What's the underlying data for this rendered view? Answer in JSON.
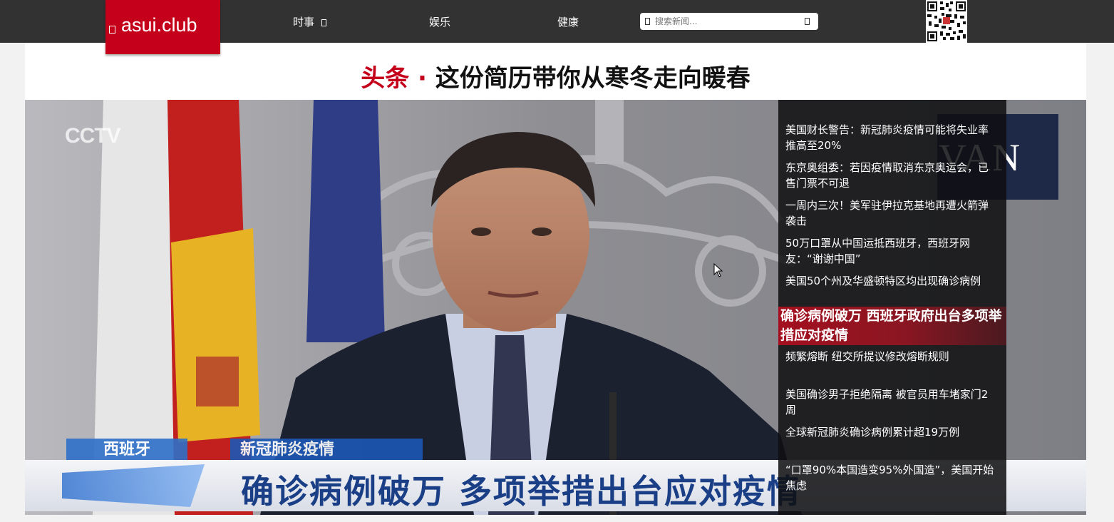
{
  "site": {
    "logo_text": "asui.club"
  },
  "nav": {
    "items": [
      {
        "label": "时事",
        "has_dropdown": true
      },
      {
        "label": "娱乐"
      },
      {
        "label": "健康"
      }
    ]
  },
  "search": {
    "placeholder": "搜索新闻..."
  },
  "headline": {
    "tag": "头条 · ",
    "title": "这份简历带你从寒冬走向暖春"
  },
  "hero": {
    "caption_tag": "西班牙",
    "caption_topic": "新冠肺炎疫情",
    "caption_main": "确诊病例破万  多项举措出台应对疫情",
    "channel_logo": "CCTV",
    "backdrop_text": "VAN"
  },
  "news": {
    "items": [
      {
        "title": "美国财长警告：新冠肺炎疫情可能将失业率推高至20%"
      },
      {
        "title": "东京奥组委：若因疫情取消东京奥运会，已售门票不可退"
      },
      {
        "title": "一周内三次！美军驻伊拉克基地再遭火箭弹袭击"
      },
      {
        "title": "50万口罩从中国运抵西班牙，西班牙网友：“谢谢中国”"
      },
      {
        "title": "美国50个州及华盛顿特区均出现确诊病例"
      }
    ],
    "featured": {
      "title": "确诊病例破万 西班牙政府出台多项举措应对疫情"
    },
    "items_after": [
      {
        "title": "频繁熔断 纽交所提议修改熔断规则"
      },
      {
        "title": "美国确诊男子拒绝隔离 被官员用车堵家门2周"
      },
      {
        "title": "全球新冠肺炎确诊病例累计超19万例"
      },
      {
        "title": "“口罩90%本国造变95%外国造”，美国开始焦虑"
      }
    ]
  },
  "colors": {
    "brand_red": "#c4001b",
    "nav_bg": "#323232",
    "panel_bg": "#0f0f12"
  }
}
